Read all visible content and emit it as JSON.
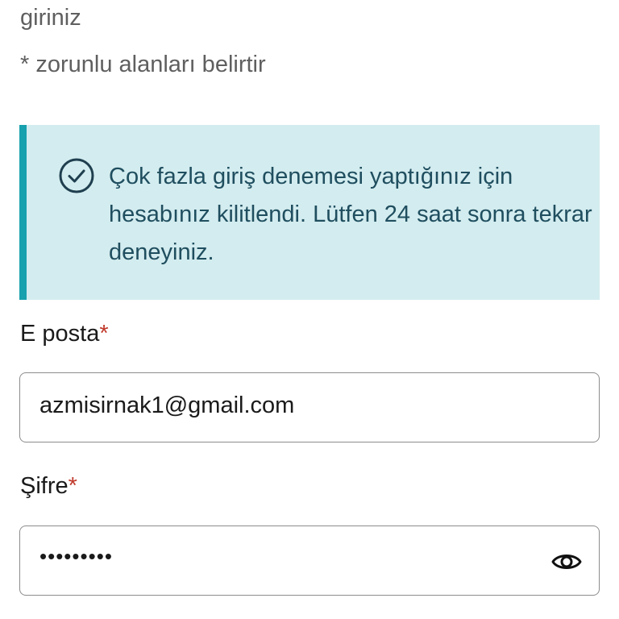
{
  "intro": {
    "top_text": "giriniz",
    "required_note": "* zorunlu alanları belirtir"
  },
  "alert": {
    "icon": "check-circle-icon",
    "message": "Çok fazla giriş denemesi yaptığınız için hesabınız kilitlendi. Lütfen 24 saat sonra tekrar deneyiniz.",
    "accent_color": "#17a0ad",
    "background_color": "#d3ecef",
    "text_color": "#1f4e5f"
  },
  "form": {
    "email": {
      "label": "E posta",
      "required_mark": "*",
      "value": "azmisirnak1@gmail.com"
    },
    "password": {
      "label": "Şifre",
      "required_mark": "*",
      "masked_value": "•••••••••",
      "toggle_icon": "eye-icon"
    },
    "required_color": "#c0392b"
  }
}
